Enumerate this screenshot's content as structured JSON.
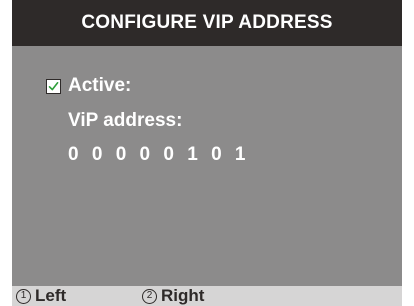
{
  "title": "CONFIGURE VIP ADDRESS",
  "active": {
    "checked": true,
    "label": "Active:",
    "check_icon": "checkmark-icon"
  },
  "vip": {
    "label": "ViP address:",
    "value": "0 0 0 0 0 1 0 1"
  },
  "softkeys": [
    {
      "number": "1",
      "label": "Left"
    },
    {
      "number": "2",
      "label": "Right"
    }
  ],
  "colors": {
    "title_bg": "#2e2a29",
    "content_bg": "#8c8b8b",
    "softkey_bg": "#d6d5d5",
    "check": "#2e9e3a"
  }
}
